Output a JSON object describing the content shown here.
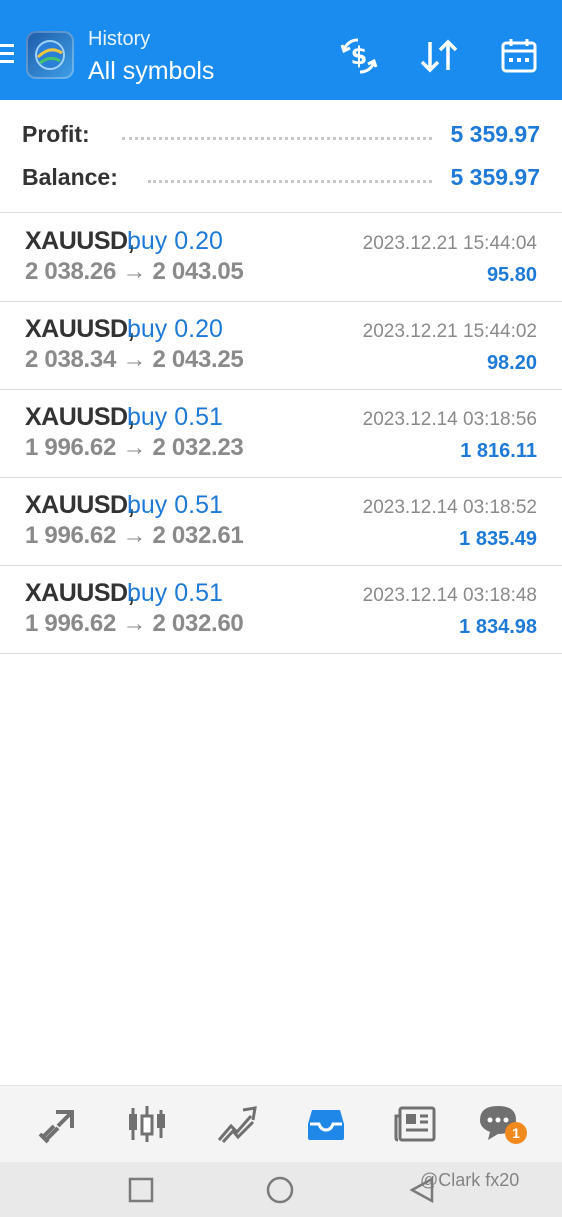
{
  "header": {
    "subtitle": "History",
    "title": "All symbols",
    "icons": [
      "menu-icon",
      "app-logo",
      "currency-exchange-icon",
      "sort-icon",
      "calendar-icon"
    ]
  },
  "summary": {
    "profit_label": "Profit:",
    "profit_value": "5 359.97",
    "balance_label": "Balance:",
    "balance_value": "5 359.97"
  },
  "deals": [
    {
      "symbol": "XAUUSD,",
      "type": "buy 0.20",
      "prices": "2 038.26 → 2 043.05",
      "time": "2023.12.21 15:44:04",
      "profit": "95.80"
    },
    {
      "symbol": "XAUUSD,",
      "type": "buy 0.20",
      "prices": "2 038.34 → 2 043.25",
      "time": "2023.12.21 15:44:02",
      "profit": "98.20"
    },
    {
      "symbol": "XAUUSD,",
      "type": "buy 0.51",
      "prices": "1 996.62 → 2 032.23",
      "time": "2023.12.14 03:18:56",
      "profit": "1 816.11"
    },
    {
      "symbol": "XAUUSD,",
      "type": "buy 0.51",
      "prices": "1 996.62 → 2 032.61",
      "time": "2023.12.14 03:18:52",
      "profit": "1 835.49"
    },
    {
      "symbol": "XAUUSD,",
      "type": "buy 0.51",
      "prices": "1 996.62 → 2 032.60",
      "time": "2023.12.14 03:18:48",
      "profit": "1 834.98"
    }
  ],
  "bottom_nav": {
    "items": [
      "quotes-icon",
      "chart-icon",
      "trade-icon",
      "history-icon",
      "news-icon",
      "chat-icon"
    ],
    "active": "history-icon",
    "chat_badge": "1"
  },
  "watermark": "@Clark fx20",
  "colors": {
    "header": "#1a8cf0",
    "accent": "#1e7ad6",
    "badge": "#f08a1c"
  }
}
